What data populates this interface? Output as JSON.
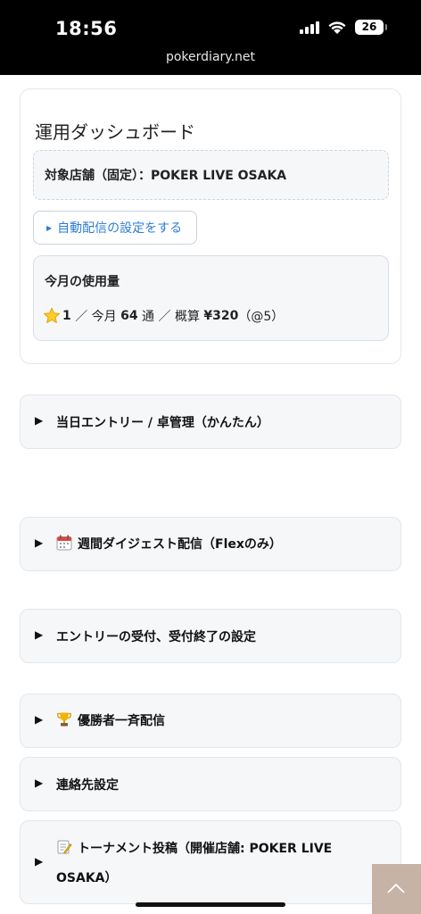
{
  "status_bar": {
    "time": "18:56",
    "battery": "26"
  },
  "browser": {
    "url": "pokerdiary.net"
  },
  "dashboard": {
    "title": "運用ダッシュボード",
    "store_label": "対象店舗（固定）：POKER LIVE OSAKA",
    "auto_delivery_button": "自動配信の設定をする",
    "usage": {
      "title": "今月の使用量",
      "count": "1",
      "sep1": "／ 今月",
      "monthly": "64",
      "unit": "通",
      "sep2": "／ 概算",
      "cost": "¥320",
      "rate": "（@5）"
    }
  },
  "sections": [
    {
      "label": "当日エントリー / 卓管理（かんたん）",
      "icon": ""
    },
    {
      "label": "週間ダイジェスト配信（Flexのみ）",
      "icon": "calendar-icon"
    },
    {
      "label": "エントリーの受付、受付終了の設定",
      "icon": ""
    },
    {
      "label": "優勝者一斉配信",
      "icon": "trophy-icon"
    },
    {
      "label": "連絡先設定",
      "icon": ""
    },
    {
      "label_line1": "トーナメント投稿（開催店舗: POKER LIVE",
      "label_line2": "OSAKA）",
      "icon": "memo-icon"
    }
  ],
  "colors": {
    "accent": "#2a7ed8",
    "go_top": "#c6b3a6",
    "section_bg": "#f6f7f9"
  }
}
